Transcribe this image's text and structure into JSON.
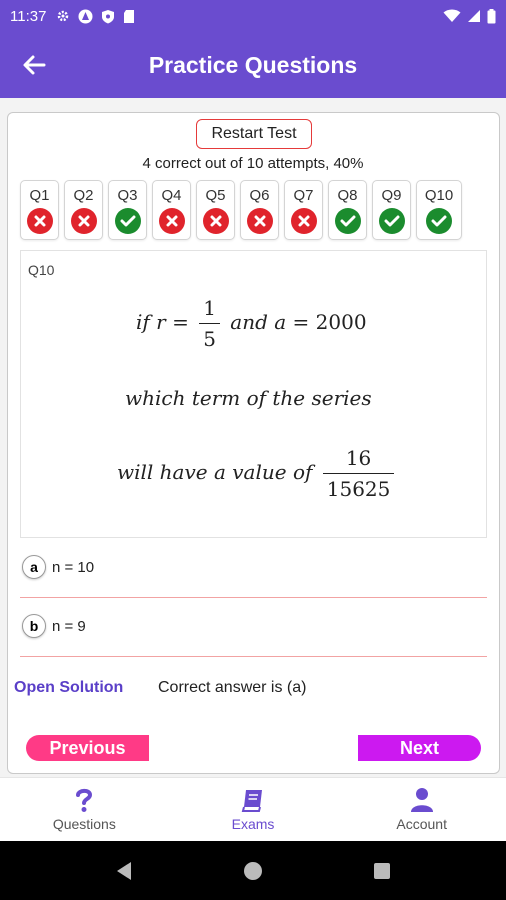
{
  "status_bar": {
    "time": "11:37"
  },
  "header": {
    "title": "Practice Questions"
  },
  "restart_label": "Restart Test",
  "score_text": "4 correct out of 10 attempts, 40%",
  "questions": [
    {
      "label": "Q1",
      "result": "wrong"
    },
    {
      "label": "Q2",
      "result": "wrong"
    },
    {
      "label": "Q3",
      "result": "correct"
    },
    {
      "label": "Q4",
      "result": "wrong"
    },
    {
      "label": "Q5",
      "result": "wrong"
    },
    {
      "label": "Q6",
      "result": "wrong"
    },
    {
      "label": "Q7",
      "result": "wrong"
    },
    {
      "label": "Q8",
      "result": "correct"
    },
    {
      "label": "Q9",
      "result": "correct"
    },
    {
      "label": "Q10",
      "result": "correct"
    }
  ],
  "question": {
    "id": "Q10",
    "line1_prefix": "if r =",
    "line1_frac_num": "1",
    "line1_frac_den": "5",
    "line1_mid": "and a =",
    "line1_value": "2000",
    "line2": "which term of the series",
    "line3_prefix": "will have a value of",
    "line3_frac_num": "16",
    "line3_frac_den": "15625"
  },
  "options": [
    {
      "key": "a",
      "text": "n = 10"
    },
    {
      "key": "b",
      "text": "n = 9"
    }
  ],
  "solution": {
    "link_label": "Open Solution",
    "answer_text": "Correct answer is (a)"
  },
  "nav_buttons": {
    "previous": "Previous",
    "next": "Next"
  },
  "bottom_nav": [
    {
      "label": "Questions",
      "icon": "question-mark-icon"
    },
    {
      "label": "Exams",
      "icon": "book-icon"
    },
    {
      "label": "Account",
      "icon": "person-icon"
    }
  ],
  "colors": {
    "primary": "#6a4ccf",
    "wrong": "#e0242c",
    "correct": "#1b8c2e",
    "previous_button": "#ff3a86",
    "next_button": "#cc19f0"
  }
}
